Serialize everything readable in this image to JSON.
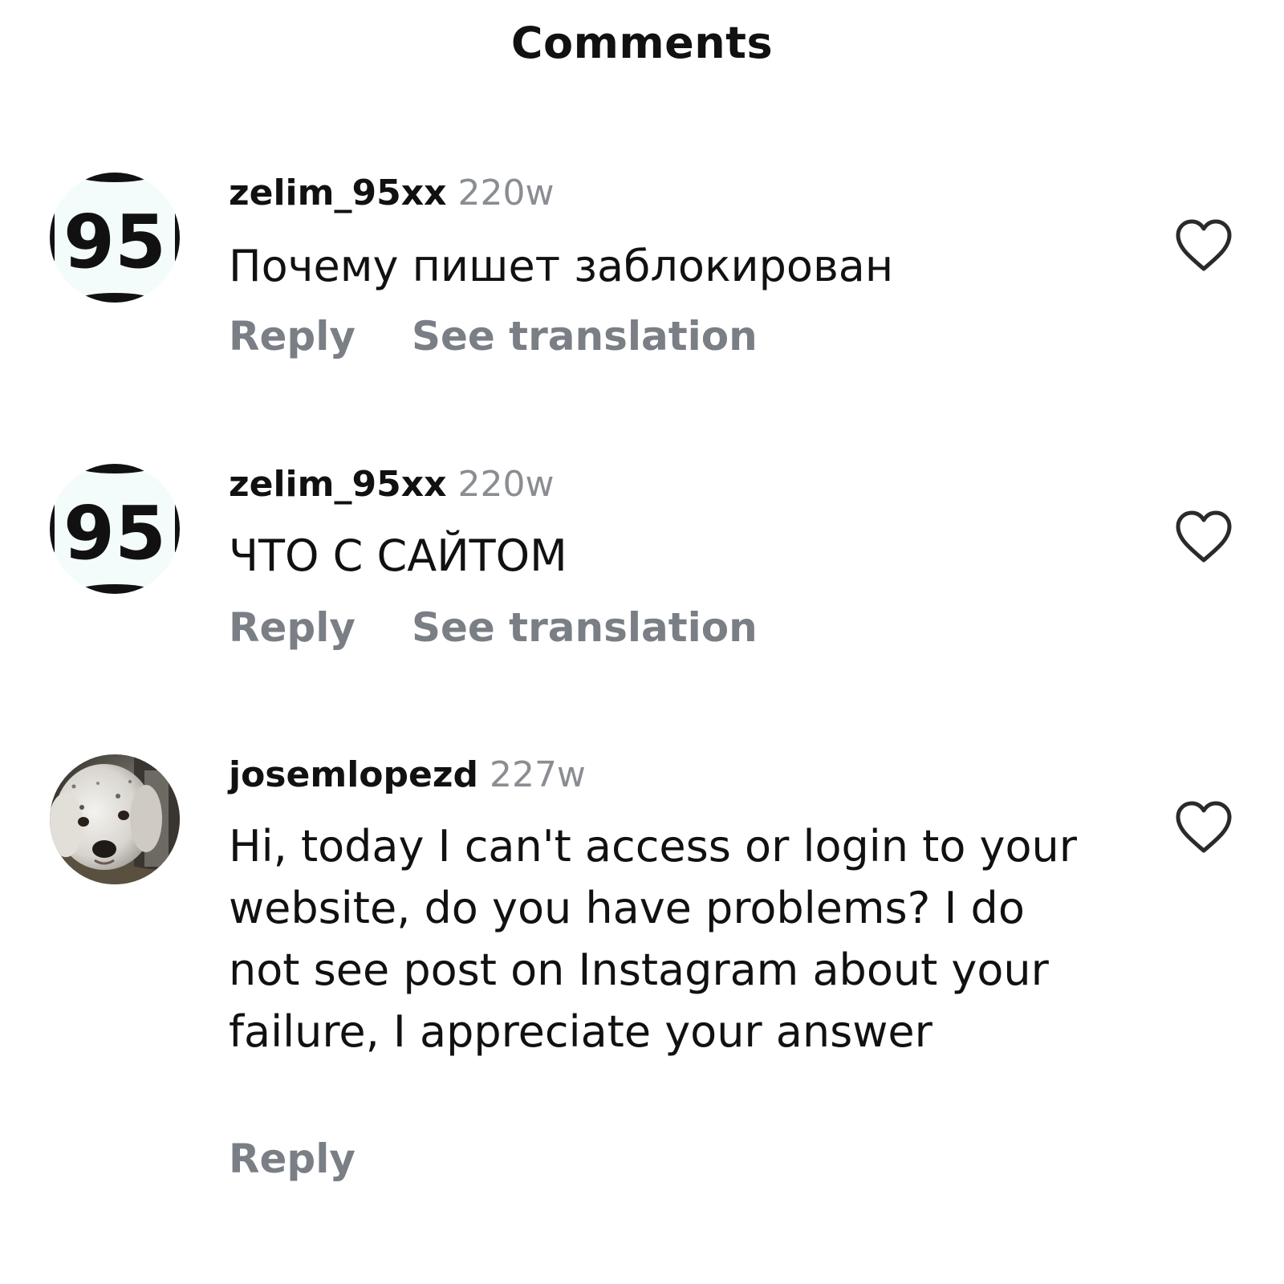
{
  "header": {
    "title": "Comments"
  },
  "comments": [
    {
      "avatar_text": "95",
      "username": "zelim_95xx",
      "time": "220w",
      "text": "Почему пишет заблокирован",
      "reply_label": "Reply",
      "translate_label": "See translation"
    },
    {
      "avatar_text": "95",
      "username": "zelim_95xx",
      "time": "220w",
      "text": "ЧТО С САЙТОМ",
      "reply_label": "Reply",
      "translate_label": "See translation"
    },
    {
      "avatar_icon": "dog-photo-icon",
      "username": "josemlopezd",
      "time": "227w",
      "text": "Hi, today I can't access or login to your website, do you have problems? I do not see post on Instagram about your failure, I appreciate your answer",
      "reply_label": "Reply"
    }
  ],
  "icons": {
    "like": "heart-outline-icon"
  },
  "colors": {
    "primary_text": "#111111",
    "secondary_text": "#8a8d92",
    "action_text": "#7a7e85",
    "background": "#ffffff"
  }
}
